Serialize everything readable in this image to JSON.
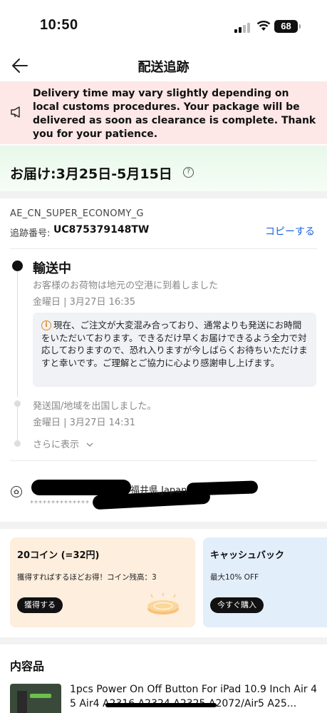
{
  "status_bar": {
    "time": "10:50",
    "battery": "68"
  },
  "nav": {
    "title": "配送追跡"
  },
  "notice": {
    "text": "Delivery time may vary slightly depending on local customs procedures. Your package will be delivered as soon as clearance is complete. Thank you for your patience."
  },
  "delivery": {
    "estimate": "お届け:3月25日-5月15日"
  },
  "tracking": {
    "carrier": "AE_CN_SUPER_ECONOMY_G",
    "number_label": "追跡番号:",
    "number": "UC875379148TW",
    "copy_label": "コピーする"
  },
  "timeline": {
    "current_status": "輸送中",
    "current_desc": "お客様のお荷物は地元の空港に到着しました",
    "current_time": "金曜日 |  3月27日  16:35",
    "info_icon": "i",
    "info_text": "現在、ご注文が大変混み合っており、通常よりも発送にお時間をいただいております。できるだけ早くお届けできるよう全力で対応しておりますので、恐れ入りますが今しばらくお待ちいただけますと幸いです。ご理解とご協力に心より感謝申し上げます。",
    "event2_desc": "発送国/地域を出国しました。",
    "event2_time": "金曜日 |  3月27日  14:31",
    "show_more": "さらに表示"
  },
  "address": {
    "location": "福井県,Japan",
    "masked": "**************"
  },
  "promos": [
    {
      "title": "20コイン (=32円)",
      "subtitle": "獲得すればするほどお得！コイン残高：3",
      "button": "獲得する"
    },
    {
      "title": "キャッシュバック",
      "subtitle": "最大10% OFF",
      "button": "今すぐ購入"
    }
  ],
  "contents": {
    "title": "内容品",
    "product_name": "1pcs Power On Off Button For iPad 10.9 Inch Air 4 5 Air4 A2316 A2324 A2325 A2072/Air5 A25..."
  },
  "colors": {
    "notice_bg": "#fde7e7",
    "delivery_bg": "#e8f8ea",
    "link": "#1a66e0",
    "promo_coin_bg": "#fdeedd",
    "promo_cashback_bg": "#e3eefb"
  }
}
